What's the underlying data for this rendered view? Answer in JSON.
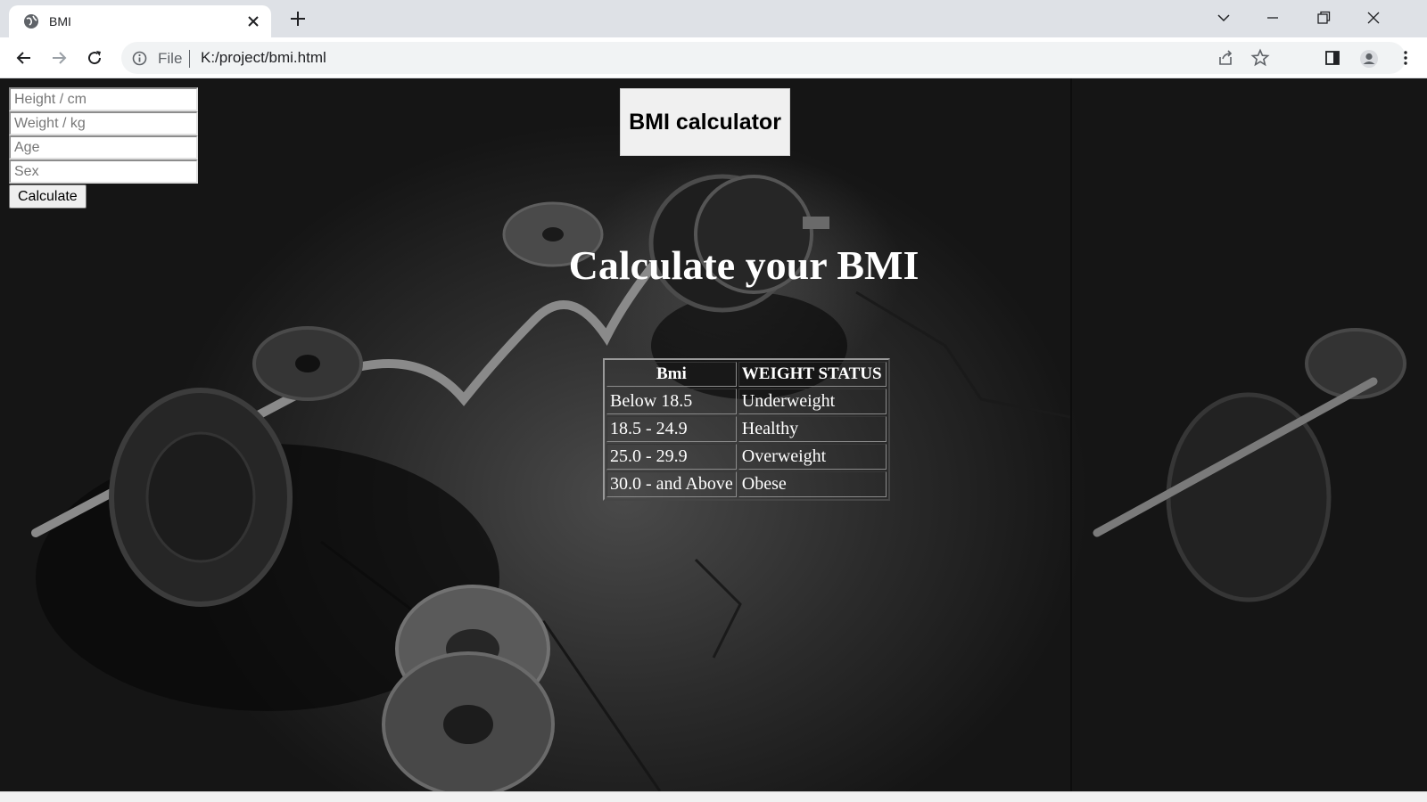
{
  "browser": {
    "tab_title": "BMI",
    "url_scheme": "File",
    "url": "K:/project/bmi.html",
    "icons": [
      "globe-icon",
      "close-icon",
      "plus-icon",
      "chevron-down-icon",
      "minimize-icon",
      "restore-icon",
      "close-window-icon",
      "back-icon",
      "forward-icon",
      "reload-icon",
      "info-icon",
      "share-icon",
      "star-icon",
      "side-panel-icon",
      "profile-icon",
      "menu-icon"
    ]
  },
  "page": {
    "form": {
      "height_placeholder": "Height / cm",
      "weight_placeholder": "Weight / kg",
      "age_placeholder": "Age",
      "sex_placeholder": "Sex",
      "calculate_label": "Calculate"
    },
    "brand_title": "BMI calculator",
    "headline": "Calculate your BMI",
    "table": {
      "headers": [
        "Bmi",
        "WEIGHT STATUS"
      ],
      "rows": [
        [
          "Below 18.5",
          "Underweight"
        ],
        [
          "18.5 - 24.9",
          "Healthy"
        ],
        [
          "25.0 - 29.9",
          "Overweight"
        ],
        [
          "30.0 - and Above",
          "Obese"
        ]
      ]
    }
  },
  "colors": {
    "chrome_tabstrip": "#dee1e6",
    "omnibox": "#f1f3f4",
    "page_text": "#ffffff",
    "brand_box": "#f0f0f0"
  }
}
